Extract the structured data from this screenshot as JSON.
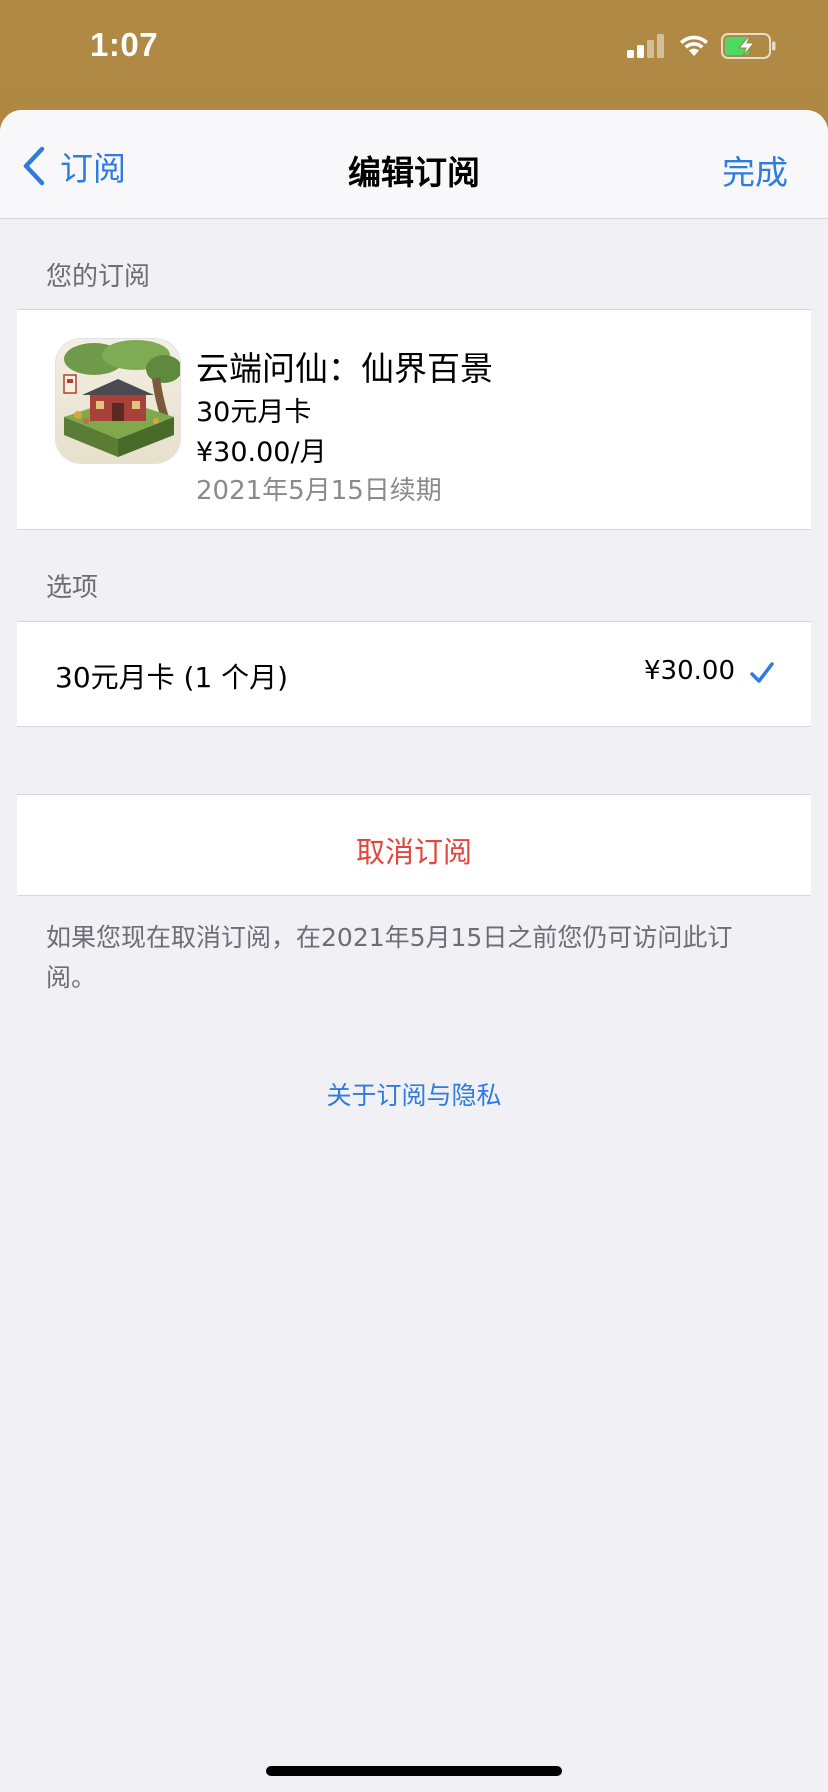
{
  "status_bar": {
    "time": "1:07"
  },
  "nav": {
    "back_label": "订阅",
    "title": "编辑订阅",
    "done_label": "完成"
  },
  "subscription_section": {
    "header": "您的订阅",
    "app_name": "云端问仙：仙界百景",
    "plan_name": "30元月卡",
    "price": "¥30.00/月",
    "renewal": "2021年5月15日续期"
  },
  "options_section": {
    "header": "选项",
    "options": [
      {
        "label": "30元月卡 (1 个月)",
        "price": "¥30.00",
        "selected": true
      }
    ]
  },
  "cancel": {
    "label": "取消订阅",
    "footnote": "如果您现在取消订阅，在2021年5月15日之前您仍可访问此订阅。"
  },
  "privacy_link": "关于订阅与隐私",
  "colors": {
    "accent_blue": "#2f7bde",
    "destructive_red": "#e0483d",
    "background": "#f0f0f5",
    "wallpaper": "#a7813f"
  },
  "icons": {
    "back": "chevron-left-icon",
    "selected": "checkmark-icon",
    "signal": "cellular-signal-icon",
    "wifi": "wifi-icon",
    "battery": "battery-charging-icon"
  }
}
